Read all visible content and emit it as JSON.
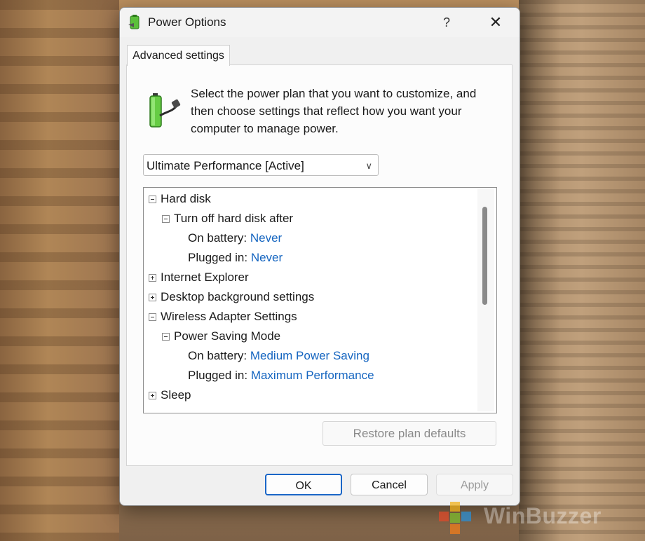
{
  "window": {
    "title": "Power Options",
    "help": "?",
    "close": "✕"
  },
  "tab": {
    "label": "Advanced settings"
  },
  "intro": {
    "text": "Select the power plan that you want to customize, and then choose settings that reflect how you want your computer to manage power."
  },
  "plan": {
    "selected": "Ultimate Performance [Active]"
  },
  "tree": {
    "hard_disk": "Hard disk",
    "turn_off": "Turn off hard disk after",
    "on_battery_label": "On battery:",
    "plugged_in_label": "Plugged in:",
    "hd_battery": "Never",
    "hd_plugged": "Never",
    "ie": "Internet Explorer",
    "desktop": "Desktop background settings",
    "wireless": "Wireless Adapter Settings",
    "psm": "Power Saving Mode",
    "wl_battery": "Medium Power Saving",
    "wl_plugged": "Maximum Performance",
    "sleep": "Sleep"
  },
  "buttons": {
    "restore": "Restore plan defaults",
    "ok": "OK",
    "cancel": "Cancel",
    "apply": "Apply"
  },
  "watermark": {
    "text": "WinBuzzer"
  },
  "colors": {
    "link": "#1565c0",
    "accent": "#1a66c7"
  }
}
